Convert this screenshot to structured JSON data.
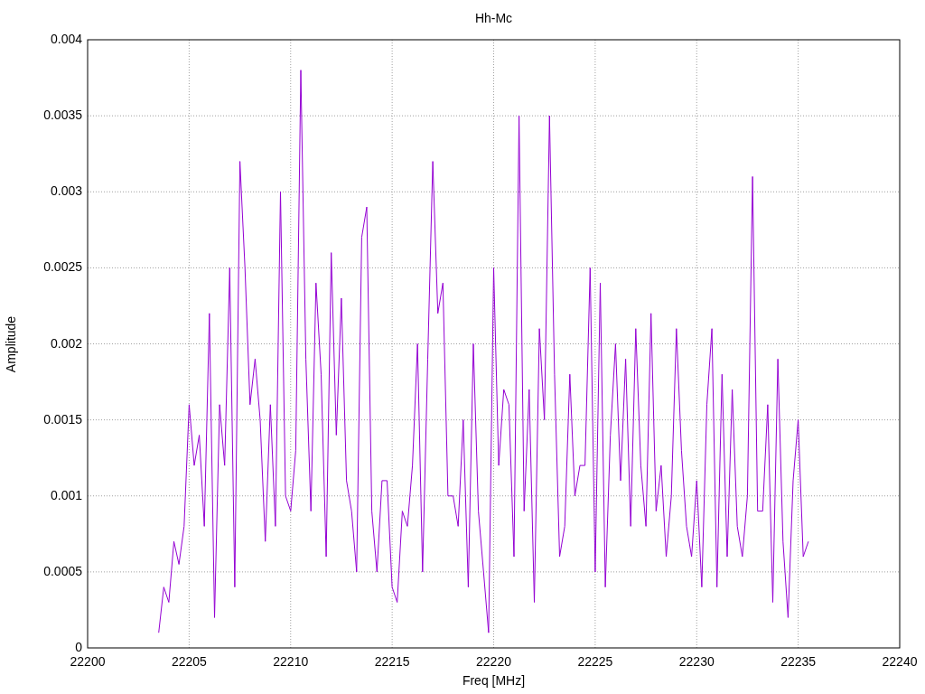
{
  "chart_data": {
    "type": "line",
    "title": "Hh-Mc",
    "xlabel": "Freq [MHz]",
    "ylabel": "Amplitude",
    "x": [
      22203.5,
      22203.75,
      22204,
      22204.25,
      22204.5,
      22204.75,
      22205,
      22205.25,
      22205.5,
      22205.75,
      22206,
      22206.25,
      22206.5,
      22206.75,
      22207,
      22207.25,
      22207.5,
      22207.75,
      22208,
      22208.25,
      22208.5,
      22208.75,
      22209,
      22209.25,
      22209.5,
      22209.75,
      22210,
      22210.25,
      22210.5,
      22210.75,
      22211,
      22211.25,
      22211.5,
      22211.75,
      22212,
      22212.25,
      22212.5,
      22212.75,
      22213,
      22213.25,
      22213.5,
      22213.75,
      22214,
      22214.25,
      22214.5,
      22214.75,
      22215,
      22215.25,
      22215.5,
      22215.75,
      22216,
      22216.25,
      22216.5,
      22216.75,
      22217,
      22217.25,
      22217.5,
      22217.75,
      22218,
      22218.25,
      22218.5,
      22218.75,
      22219,
      22219.25,
      22219.5,
      22219.75,
      22220,
      22220.25,
      22220.5,
      22220.75,
      22221,
      22221.25,
      22221.5,
      22221.75,
      22222,
      22222.25,
      22222.5,
      22222.75,
      22223,
      22223.25,
      22223.5,
      22223.75,
      22224,
      22224.25,
      22224.5,
      22224.75,
      22225,
      22225.25,
      22225.5,
      22225.75,
      22226,
      22226.25,
      22226.5,
      22226.75,
      22227,
      22227.25,
      22227.5,
      22227.75,
      22228,
      22228.25,
      22228.5,
      22228.75,
      22229,
      22229.25,
      22229.5,
      22229.75,
      22230,
      22230.25,
      22230.5,
      22230.75,
      22231,
      22231.25,
      22231.5,
      22231.75,
      22232,
      22232.25,
      22232.5,
      22232.75,
      22233,
      22233.25,
      22233.5,
      22233.75,
      22234,
      22234.25,
      22234.5,
      22234.75,
      22235,
      22235.25,
      22235.5
    ],
    "series": [
      {
        "color": "#9400d3",
        "values": [
          0.0001,
          0.0004,
          0.0003,
          0.0007,
          0.00055,
          0.0008,
          0.0016,
          0.0012,
          0.0014,
          0.0008,
          0.0022,
          0.0002,
          0.0016,
          0.0012,
          0.0025,
          0.0004,
          0.0032,
          0.0025,
          0.0016,
          0.0019,
          0.0015,
          0.0007,
          0.0016,
          0.0008,
          0.003,
          0.001,
          0.0009,
          0.0013,
          0.0038,
          0.0019,
          0.0009,
          0.0024,
          0.0018,
          0.0006,
          0.0026,
          0.0014,
          0.0023,
          0.0011,
          0.0009,
          0.0005,
          0.0027,
          0.0029,
          0.0009,
          0.0005,
          0.0011,
          0.0011,
          0.0004,
          0.0003,
          0.0009,
          0.0008,
          0.0012,
          0.002,
          0.0005,
          0.0019,
          0.0032,
          0.0022,
          0.0024,
          0.001,
          0.001,
          0.0008,
          0.0015,
          0.0004,
          0.002,
          0.0009,
          0.0005,
          0.0001,
          0.0025,
          0.0012,
          0.0017,
          0.0016,
          0.0006,
          0.0035,
          0.0009,
          0.0017,
          0.0003,
          0.0021,
          0.0015,
          0.0035,
          0.0018,
          0.0006,
          0.0008,
          0.0018,
          0.001,
          0.0012,
          0.0012,
          0.0025,
          0.0005,
          0.0024,
          0.0004,
          0.0014,
          0.002,
          0.0011,
          0.0019,
          0.0008,
          0.0021,
          0.0012,
          0.0008,
          0.0022,
          0.0009,
          0.0012,
          0.0006,
          0.001,
          0.0021,
          0.0013,
          0.0008,
          0.0006,
          0.0011,
          0.0004,
          0.0016,
          0.0021,
          0.0004,
          0.0018,
          0.0006,
          0.0017,
          0.0008,
          0.0006,
          0.001,
          0.0031,
          0.0009,
          0.0009,
          0.0016,
          0.0003,
          0.0019,
          0.0007,
          0.0002,
          0.0011,
          0.0015,
          0.0006,
          0.0007
        ]
      }
    ],
    "grid": true,
    "xlim": [
      22200,
      22240
    ],
    "ylim": [
      0,
      0.004
    ],
    "xticks": [
      22200,
      22205,
      22210,
      22215,
      22220,
      22225,
      22230,
      22235,
      22240
    ],
    "yticks": [
      0,
      0.0005,
      0.001,
      0.0015,
      0.002,
      0.0025,
      0.003,
      0.0035,
      0.004
    ]
  }
}
